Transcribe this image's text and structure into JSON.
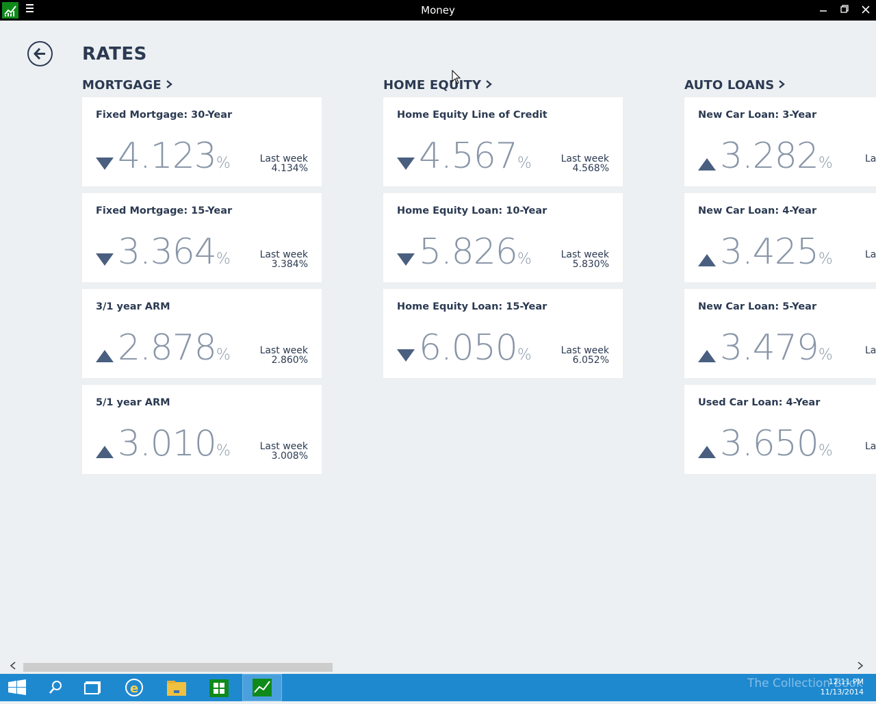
{
  "window": {
    "title": "Money"
  },
  "page": {
    "title": "RATES"
  },
  "sections": [
    {
      "heading": "MORTGAGE",
      "cards": [
        {
          "name": "Fixed Mortgage: 30-Year",
          "rate": "4.123",
          "trend": "down",
          "last_week_label": "Last week",
          "last_week": "4.134%"
        },
        {
          "name": "Fixed Mortgage: 15-Year",
          "rate": "3.364",
          "trend": "down",
          "last_week_label": "Last week",
          "last_week": "3.384%"
        },
        {
          "name": "3/1 year ARM",
          "rate": "2.878",
          "trend": "up",
          "last_week_label": "Last week",
          "last_week": "2.860%"
        },
        {
          "name": "5/1 year ARM",
          "rate": "3.010",
          "trend": "up",
          "last_week_label": "Last week",
          "last_week": "3.008%"
        }
      ]
    },
    {
      "heading": "HOME EQUITY",
      "cards": [
        {
          "name": "Home Equity Line of Credit",
          "rate": "4.567",
          "trend": "down",
          "last_week_label": "Last week",
          "last_week": "4.568%"
        },
        {
          "name": "Home Equity Loan: 10-Year",
          "rate": "5.826",
          "trend": "down",
          "last_week_label": "Last week",
          "last_week": "5.830%"
        },
        {
          "name": "Home Equity Loan: 15-Year",
          "rate": "6.050",
          "trend": "down",
          "last_week_label": "Last week",
          "last_week": "6.052%"
        }
      ]
    },
    {
      "heading": "AUTO LOANS",
      "cards": [
        {
          "name": "New Car Loan: 3-Year",
          "rate": "3.282",
          "trend": "up",
          "last_week_label": "La"
        },
        {
          "name": "New Car Loan: 4-Year",
          "rate": "3.425",
          "trend": "up",
          "last_week_label": "La"
        },
        {
          "name": "New Car Loan: 5-Year",
          "rate": "3.479",
          "trend": "up",
          "last_week_label": "La"
        },
        {
          "name": "Used Car Loan: 4-Year",
          "rate": "3.650",
          "trend": "up",
          "last_week_label": "La"
        }
      ]
    }
  ],
  "percent_sign": "%",
  "taskbar": {
    "time": "12:11 PM",
    "date": "11/13/2014",
    "watermark": "The Collection Book"
  },
  "colors": {
    "title_bar": "#000000",
    "app_icon": "#0f8a1a",
    "background": "#edf0f2",
    "heading_text": "#2b3a52",
    "rate_text": "#8996a8",
    "taskbar": "#1f89d0"
  },
  "icons": [
    "money-app-icon",
    "hamburger-menu-icon",
    "minimize-icon",
    "maximize-icon",
    "close-icon",
    "back-arrow-icon",
    "chevron-right-icon",
    "trend-down-icon",
    "trend-up-icon",
    "windows-start-icon",
    "search-icon",
    "task-view-icon",
    "internet-explorer-icon",
    "file-explorer-icon",
    "store-icon",
    "money-taskbar-icon"
  ]
}
